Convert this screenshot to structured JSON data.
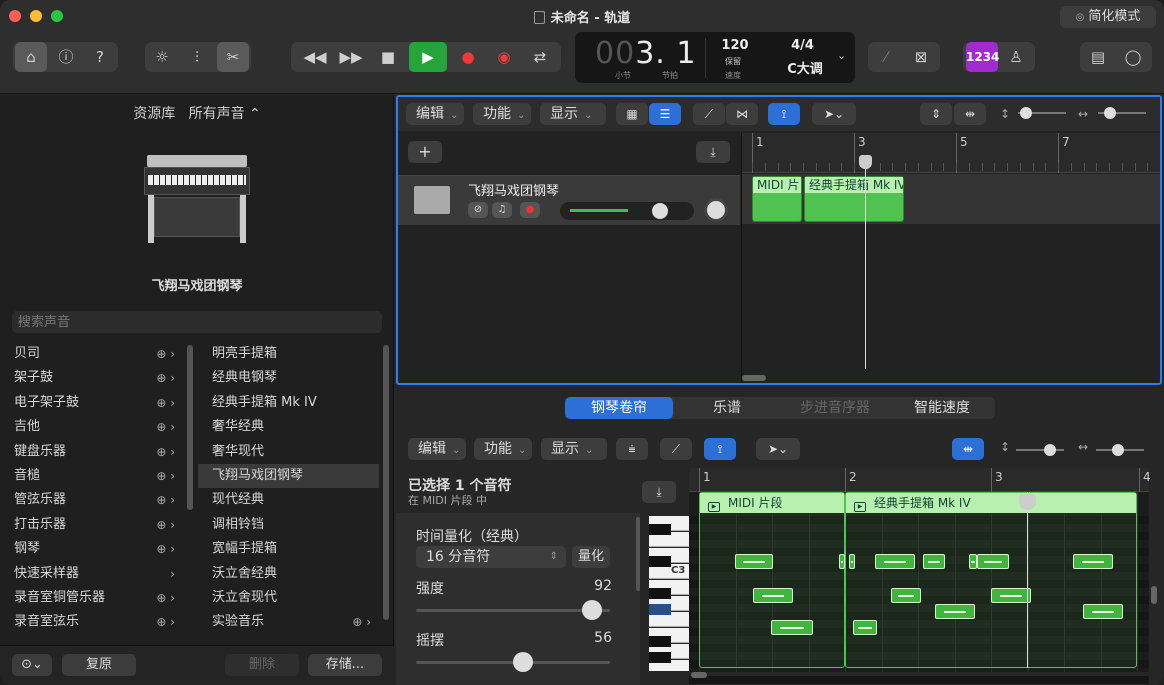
{
  "window": {
    "title": "未命名 - 轨道",
    "simple_mode": "简化模式"
  },
  "lcd": {
    "bar_dim": "00",
    "position": "3. 1",
    "bar_label": "小节",
    "beat_label": "节拍",
    "tempo": "120",
    "tempo_mode": "保留",
    "tempo_label": "速度",
    "time_sig": "4/4",
    "key": "C大调"
  },
  "toolbar": {
    "count_in": "1234"
  },
  "library": {
    "header": "资源库",
    "filter": "所有声音 ⌃",
    "instrument_name": "飞翔马戏团钢琴",
    "search_placeholder": "搜索声音",
    "categories": [
      {
        "label": "贝司",
        "dl": true
      },
      {
        "label": "架子鼓",
        "dl": true
      },
      {
        "label": "电子架子鼓",
        "dl": true
      },
      {
        "label": "吉他",
        "dl": true
      },
      {
        "label": "键盘乐器",
        "dl": true
      },
      {
        "label": "音槌",
        "dl": true
      },
      {
        "label": "管弦乐器",
        "dl": true
      },
      {
        "label": "打击乐器",
        "dl": true
      },
      {
        "label": "钢琴",
        "dl": true
      },
      {
        "label": "快速采样器",
        "dl": false
      },
      {
        "label": "录音室铜管乐器",
        "dl": true
      },
      {
        "label": "录音室弦乐",
        "dl": true
      }
    ],
    "patches": [
      "明亮手提箱",
      "经典电钢琴",
      "经典手提箱 Mk IV",
      "奢华经典",
      "奢华现代",
      "飞翔马戏团钢琴",
      "现代经典",
      "调相铃铛",
      "宽幅手提箱",
      "沃立舍经典",
      "沃立舍现代",
      "实验音乐"
    ],
    "selected_patch": 5,
    "footer": {
      "revert": "复原",
      "delete": "删除",
      "save": "存储..."
    }
  },
  "tracks_area": {
    "menus": {
      "edit": "编辑",
      "function": "功能",
      "view": "显示"
    },
    "ruler": [
      "1",
      "3",
      "5",
      "7"
    ],
    "track": {
      "name": "飞翔马戏团钢琴"
    },
    "regions": [
      "MIDI 片",
      "经典手提箱 Mk IV"
    ]
  },
  "editor": {
    "tabs": [
      "钢琴卷帘",
      "乐谱",
      "步进音序器",
      "智能速度"
    ],
    "menus": {
      "edit": "编辑",
      "function": "功能",
      "view": "显示"
    },
    "selection": "已选择 1 个音符",
    "selection_sub": "在 MIDI 片段 中",
    "quantize_label": "时间量化（经典）",
    "quantize_value": "16 分音符",
    "quantize_button": "量化",
    "velocity_label": "强度",
    "velocity_value": "92",
    "velocity_frac": 0.92,
    "swing_label": "摇摆",
    "swing_value": "56",
    "swing_frac": 0.56,
    "ruler": [
      "1",
      "2",
      "3",
      "4"
    ],
    "key_label": "C3",
    "regions": [
      "MIDI 片段",
      "经典手提箱 Mk IV"
    ]
  }
}
